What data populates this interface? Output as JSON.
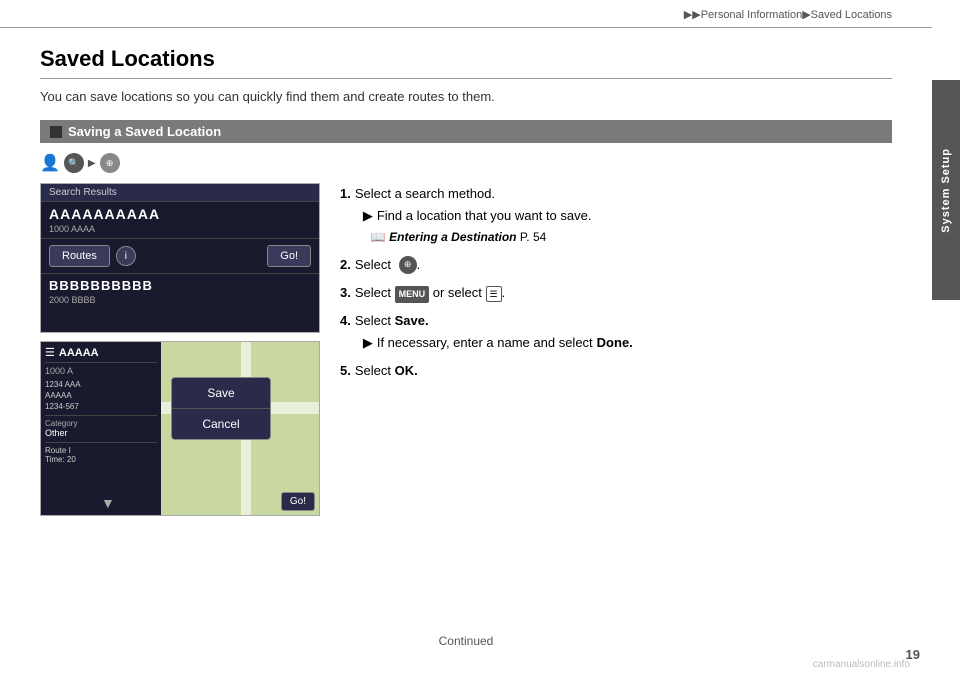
{
  "breadcrumb": {
    "text": "▶▶Personal Information▶Saved Locations"
  },
  "side_tab": {
    "label": "System Setup"
  },
  "page": {
    "title": "Saved Locations",
    "description": "You can save locations so you can quickly find them and create routes to them."
  },
  "section": {
    "header": "Saving a Saved Location"
  },
  "screenshot1": {
    "header": "Search Results",
    "result_a": "AAAAAAAAAA",
    "subtext_a": "1000 AAAA",
    "btn_routes": "Routes",
    "btn_go": "Go!",
    "result_b": "BBBBBBBBBB",
    "subtext_b": "2000 BBBB"
  },
  "screenshot2": {
    "name": "AAAAA",
    "addr_line1": "1000 A",
    "row1_a": "1234 AAA",
    "row1_b": "AAAAA",
    "row2": "1234-567",
    "category_label": "Category",
    "category_value": "Other",
    "route_label": "Route I",
    "route_time": "Time: 20",
    "dialog_save": "Save",
    "dialog_cancel": "Cancel",
    "go_btn": "Go!"
  },
  "instructions": {
    "step1_num": "1.",
    "step1_text": "Select a search method.",
    "step1_sub1": "Find a location that you want to save.",
    "step1_ref_label": "Entering a Destination",
    "step1_ref_page": "P. 54",
    "step2_num": "2.",
    "step2_text": "Select",
    "step3_num": "3.",
    "step3_text": "Select",
    "step3_mid": "or select",
    "step4_num": "4.",
    "step4_text": "Select",
    "step4_bold": "Save.",
    "step4_sub": "If necessary, enter a name and select",
    "step4_bold2": "Done.",
    "step5_num": "5.",
    "step5_text": "Select",
    "step5_bold": "OK."
  },
  "footer": {
    "continued": "Continued",
    "page_number": "19",
    "watermark": "carmanualsonline.info"
  }
}
